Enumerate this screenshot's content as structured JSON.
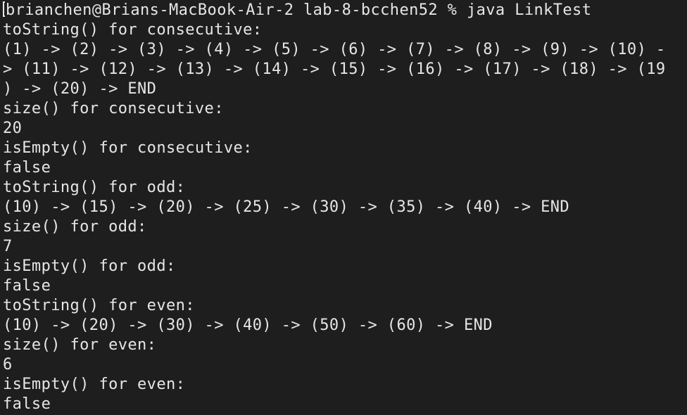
{
  "terminal": {
    "prompt": "brianchen@Brians-MacBook-Air-2 lab-8-bcchen52 % java LinkTest",
    "lines": [
      "toString() for consecutive:",
      "(1) -> (2) -> (3) -> (4) -> (5) -> (6) -> (7) -> (8) -> (9) -> (10) -",
      "> (11) -> (12) -> (13) -> (14) -> (15) -> (16) -> (17) -> (18) -> (19",
      ") -> (20) -> END",
      "size() for consecutive:",
      "20",
      "isEmpty() for consecutive:",
      "false",
      "toString() for odd:",
      "(10) -> (15) -> (20) -> (25) -> (30) -> (35) -> (40) -> END",
      "size() for odd:",
      "7",
      "isEmpty() for odd:",
      "false",
      "toString() for even:",
      "(10) -> (20) -> (30) -> (40) -> (50) -> (60) -> END",
      "size() for even:",
      "6",
      "isEmpty() for even:",
      "false"
    ]
  },
  "colors": {
    "background": "#1e1e1e",
    "foreground": "#e6e6e6"
  }
}
